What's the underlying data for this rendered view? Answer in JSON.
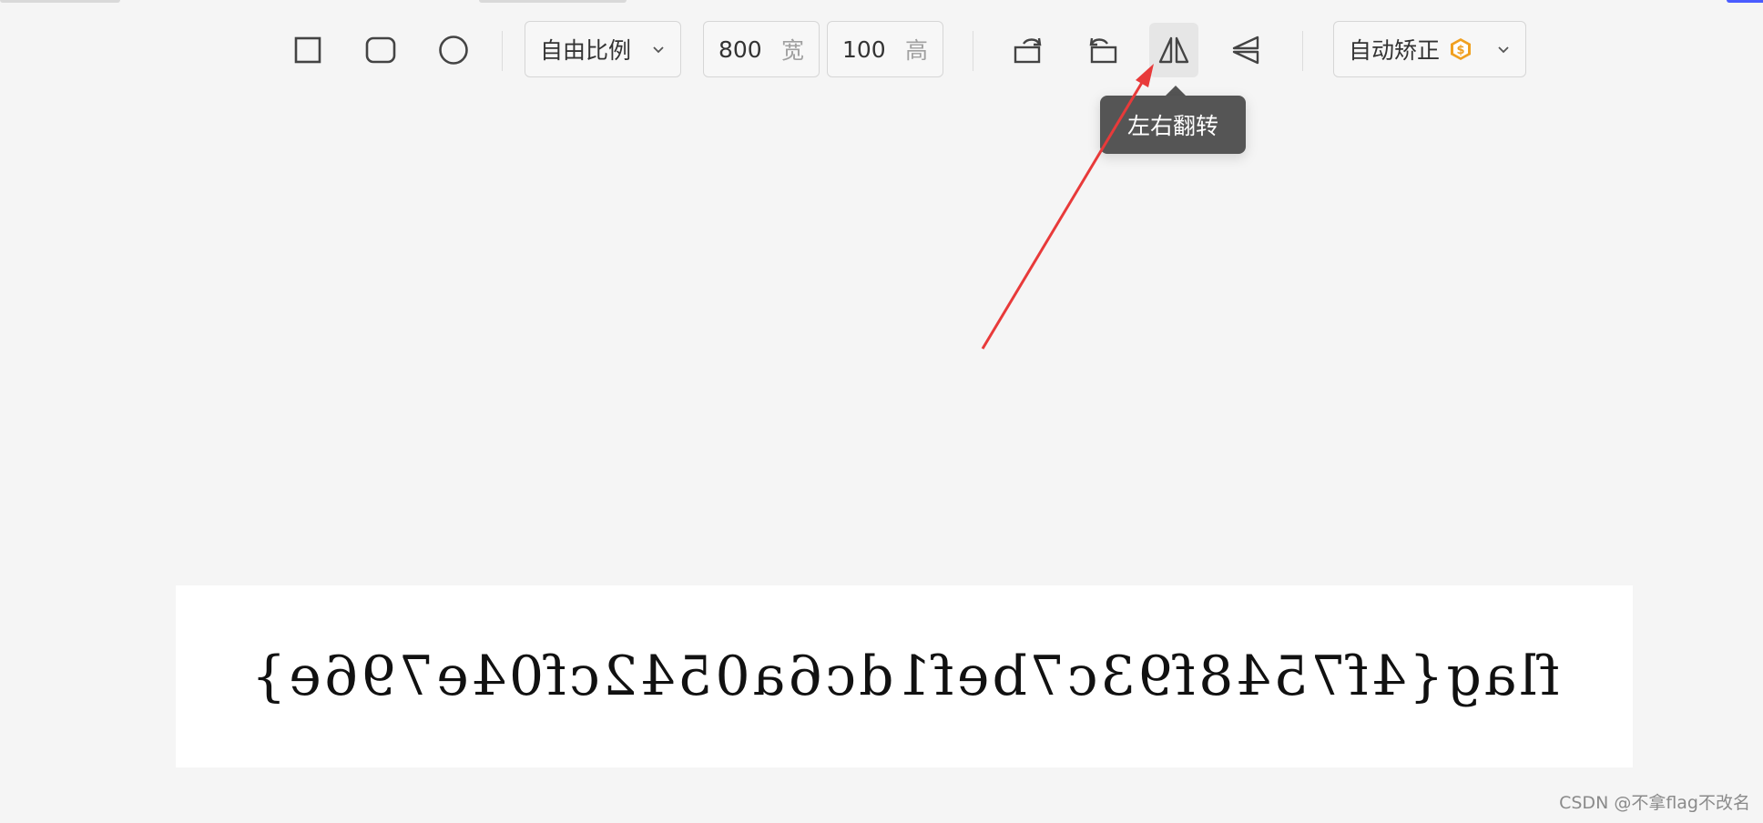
{
  "toolbar": {
    "shapes": [
      {
        "icon": "square-crop-icon"
      },
      {
        "icon": "rounded-square-crop-icon"
      },
      {
        "icon": "circle-crop-icon"
      }
    ],
    "ratio_select": {
      "value": "自由比例",
      "icon": "chevron-down-icon"
    },
    "width": {
      "value": "800",
      "unit": "宽"
    },
    "height": {
      "value": "100",
      "unit": "高"
    },
    "transform_buttons": [
      {
        "icon": "rotate-left-icon"
      },
      {
        "icon": "rotate-right-icon"
      },
      {
        "icon": "flip-horizontal-icon",
        "active": true
      },
      {
        "icon": "flip-vertical-icon"
      }
    ],
    "auto_correct": {
      "label": "自动矫正",
      "badge_icon": "premium-coin-icon",
      "badge_color": "#f0a020"
    }
  },
  "tooltip": {
    "text": "左右翻转"
  },
  "annotation": {
    "color": "#e83a3a"
  },
  "canvas": {
    "image_text": "flag{4f7548f93c7bef1dc6a0542cf04e796e}",
    "mirrored": true
  },
  "watermark": "CSDN @不拿flag不改名"
}
